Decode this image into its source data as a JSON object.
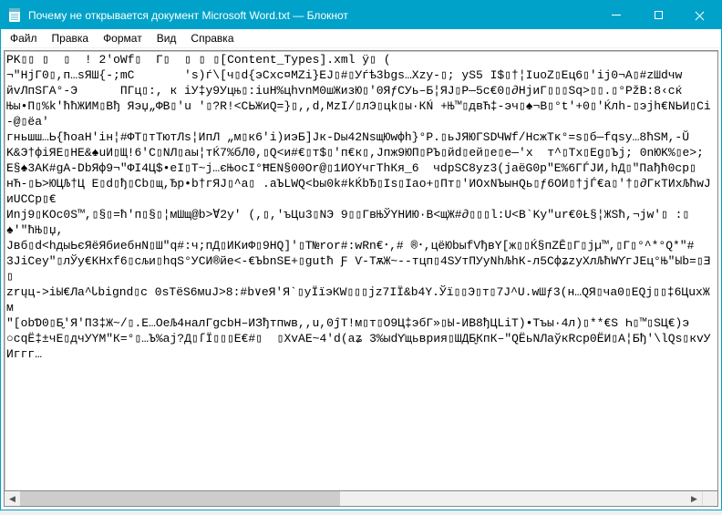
{
  "title": "Почему не открывается документ Microsoft Word.txt — Блокнот",
  "win_controls": {
    "minimize": "minimize",
    "maximize": "maximize",
    "close": "close"
  },
  "menu": {
    "file": "Файл",
    "edit": "Правка",
    "format": "Формат",
    "view": "Вид",
    "help": "Справка"
  },
  "content": {
    "l01": "PK▯▯ ▯  ▯  ! 2'oWf▯  Г▯  ▯ ▯ ▯[Content_Types].xml ÿ▯ (",
    "l02": "",
    "l03": "¬\"HjГ0▯,п…sЯШ{-;mC       's)ѓ\\[ч▯d{эCxc¤MZi}EJ▯#▯Уѓѣ3bgs…Xzy-▯; yS5 I$▯†¦IuoZ▯Eц6▯'ij0¬A▯#zШdчw",
    "l04": "йvЛпSГA°-Э      ПГц▯:, к iУ‡y9Уцњ▯:iuH%цhvnM0шЖизЮ▯'0ЯƒCУь–Б¦ЯЈ▯Р—5с€0▯∂HјиГ▯▯▯Sq>▯▯.▯°PžВ:8‹сќ",
    "l05": "Њы•П▯%k'ћћЖИM▯Bђ Яэџ„ФВ▯'u '▯?R!<CЬЖиQ=}▯,,d,MzI/▯лЭ▯цk▯ы·КŃ +Њ™▯двЋ‡-эч▯♠¬В▯°t'+0▯'Ќлh-▯эјh€NЬИ▯Ci-@▯ëа'",
    "l06": "гньшш…Ь{ћoаH'iн¦#ФТ▯тTютЛs¦ИпЛ „м▯к6'i)иэБ]Jк-Dы42NѕщЮwфh}°Р.▯ьЈЯЮГSDЧWf/HcжTĸ°=ѕ▯б—fqsy…8ħSМ,-Ŭ",
    "l07": "K&Э†фiЯЕ▯НЕ&♠uИ▯Щ!6'C▯NЛ▯аы¦тЌ7%бЛ0,▯Q<и#€▯т$▯'п€к▯,Jпж9ЮП▯PЪ▯йd▯eй▯e▯e—'x  т^▯Tх▯Eg▯Ъј; 0nЮK%▯e>;",
    "l08": "Е§♠3АК#gА-DbЯф9¬\"ФI4Ц$•eI▯T~j…єЊоcI°ĦEN§00Or@▯1ИОYчгThКя_6  чdрSC8yz3(jаёG0p\"E%6ГЃJИ,hД▯\"Пађћ0сp▯",
    "l09": "нЋ-▯Ь>ЮЦЉ†Ц E▯d▯ђ▯Cb▯щ,Ђр•b†гЯЈ▯^а▯ .аЪLWQ<bы0k#kЌbЂ▯Is▯Iаo+▯Пт▯'ИОхNЪынQь▯ƒ6ОИ▯†jЃ€a▯'†▯∂ГкТИхЉћwJиUCCp▯€",
    "l10": "Иnj9▯KОc0Ѕ™,▯§▯=ћ'п▯§▯¦мШщ@b>Ɐ2у' (,▯,'ъЦu3▯NЭ 9▯▯ГвЊЎYНИЮ·В<щЖ#∂▯▯▯l:U<B`Ky\"ur€0Ł§¦ЖSħ,¬jw'▯ :▯♠'\"ħЊ▯џ,",
    "l11": "Jвб▯d<hдыЬєЯёЯбиебнN▯Ш\"q#:ч;пД▯ИКиФ▯9HQ]'▯T№ror#:wRn€･,# ®･,цёЮbыfVђвY[ж▯▯Ќ§пZĒ▯Г▯jµ™,▯Г▯°^*°Q*\"#",
    "l12": "3JiCey\"▯лЎy€КНxf6▯сљи▯hqS°УCИ®йе<-€ЪbnSE+▯gutħ Ƒ Ѵ-ТѫЖ~--тцп▯4SУтПУуNhЉhК-л5СфʑzуХлЉћWϒгJEц°Њ\"Ыb=▯Ǝ▯",
    "l13": "zrųц->iЫ€Лa^Ꮣbignd▯с 0sTёS6мuJ>8:#b∨еЯ'Я`▯уЇïэКW▯▯▯јz7IЇ&b4Y.Ўї▯▯Э▯т▯7J^U.wШƒ3(н…QЯ▯ча0▯EQj▯▯‡6ЦuxЖм",
    "l14": "\"[obƊ0▯Б̬'Я'П3‡Ж~/▯.Е…OeЉ4нaлГgcbH–ИЗђтпwв,,u,0ĵT!м▯т▯О9Ц‡эбГ»▯Ы-ИВ8ђЦLiТ)•Tъы·4л)▯**€S Һ▯™▯SЦ€)э",
    "l15": "○сqЁ‡±чЕ▯дчУYM\"К=°▯…Ъ%aј?Д▯ſЇ▯▯▯E€#▯  ▯XvАE~4'd(aʑ 3%ыdϒщьврия▯ШДБ̬КпК–\"QЁьNЛаўкRcp0ЁИ▯А¦Бђ'\\lQs▯кvУИггг…"
  }
}
